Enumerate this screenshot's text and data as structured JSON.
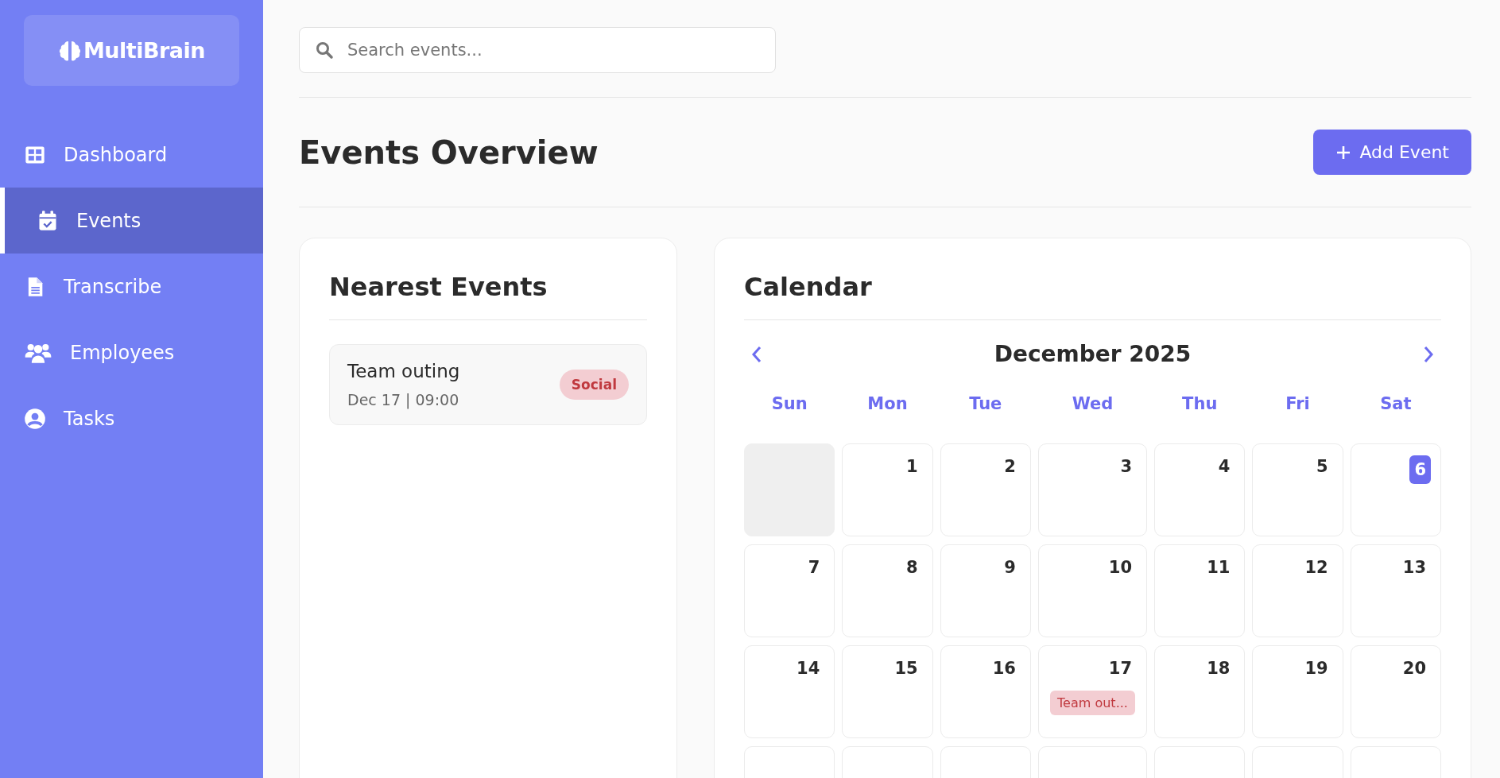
{
  "sidebar": {
    "logo": "MultiBrain",
    "items": [
      {
        "label": "Dashboard",
        "kind": "grid",
        "selected": false
      },
      {
        "label": "Events",
        "kind": "calendar",
        "selected": true
      },
      {
        "label": "Transcribe",
        "kind": "document",
        "selected": false
      },
      {
        "label": "Employees",
        "kind": "people",
        "selected": false
      },
      {
        "label": "Tasks",
        "kind": "user",
        "selected": false
      }
    ]
  },
  "search": {
    "placeholder": "Search events..."
  },
  "page_title": "Events Overview",
  "add_button": "Add Event",
  "nearest_events": {
    "title": "Nearest Events",
    "events": [
      {
        "name": "Team outing",
        "when": "Dec 17 | 09:00",
        "tag": "Social",
        "color": "#f3cdd2"
      }
    ]
  },
  "calendar": {
    "title": "Calendar",
    "month": "December 2025",
    "weekdays": [
      "Sun",
      "Mon",
      "Tue",
      "Wed",
      "Thu",
      "Fri",
      "Sat"
    ],
    "weeks": [
      [
        {
          "kind": "blank"
        },
        {
          "kind": "day",
          "day": "1",
          "today": false
        },
        {
          "kind": "day",
          "day": "2",
          "today": false
        },
        {
          "kind": "day",
          "day": "3",
          "today": false
        },
        {
          "kind": "day",
          "day": "4",
          "today": false
        },
        {
          "kind": "day",
          "day": "5",
          "today": false
        },
        {
          "kind": "day",
          "day": "6",
          "today": true
        }
      ],
      [
        {
          "kind": "day",
          "day": "7",
          "today": false
        },
        {
          "kind": "day",
          "day": "8",
          "today": false
        },
        {
          "kind": "day",
          "day": "9",
          "today": false
        },
        {
          "kind": "day",
          "day": "10",
          "today": false
        },
        {
          "kind": "day",
          "day": "11",
          "today": false
        },
        {
          "kind": "day",
          "day": "12",
          "today": false
        },
        {
          "kind": "day",
          "day": "13",
          "today": false
        }
      ],
      [
        {
          "kind": "day",
          "day": "14",
          "today": false
        },
        {
          "kind": "day",
          "day": "15",
          "today": false
        },
        {
          "kind": "day",
          "day": "16",
          "today": false
        },
        {
          "kind": "day",
          "day": "17",
          "today": false,
          "events": [
            {
              "label": "Team out...",
              "color": "#f3cdd2"
            }
          ]
        },
        {
          "kind": "day",
          "day": "18",
          "today": false
        },
        {
          "kind": "day",
          "day": "19",
          "today": false
        },
        {
          "kind": "day",
          "day": "20",
          "today": false
        }
      ],
      [
        {
          "kind": "cut"
        },
        {
          "kind": "cut"
        },
        {
          "kind": "cut"
        },
        {
          "kind": "cut"
        },
        {
          "kind": "cut"
        },
        {
          "kind": "cut"
        },
        {
          "kind": "cut"
        }
      ]
    ]
  }
}
